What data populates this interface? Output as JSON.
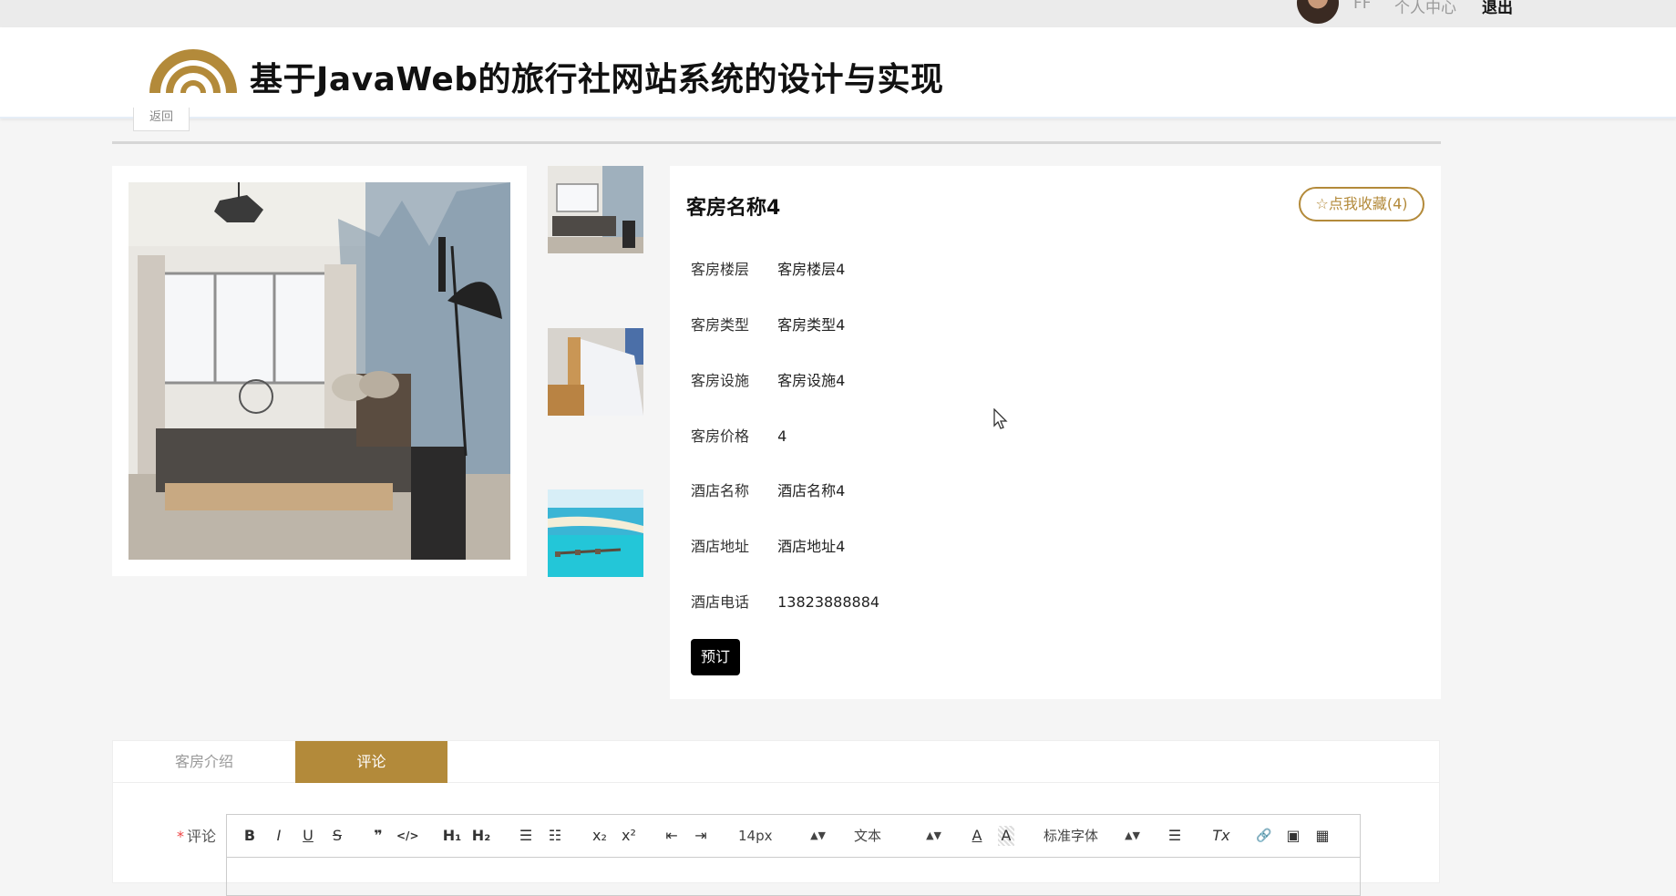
{
  "topbar": {
    "user_initial": "FF",
    "personal_center": "个人中心",
    "logout": "退出"
  },
  "header": {
    "site_title": "基于JavaWeb的旅行社网站系统的设计与实现",
    "accent_color": "#b38a3a"
  },
  "back_label": "返回",
  "room": {
    "title": "客房名称4",
    "favorite_label": "☆点我收藏(4)",
    "fields": [
      {
        "label": "客房楼层",
        "value": "客房楼层4"
      },
      {
        "label": "客房类型",
        "value": "客房类型4"
      },
      {
        "label": "客房设施",
        "value": "客房设施4"
      },
      {
        "label": "客房价格",
        "value": "4"
      },
      {
        "label": "酒店名称",
        "value": "酒店名称4"
      },
      {
        "label": "酒店地址",
        "value": "酒店地址4"
      },
      {
        "label": "酒店电话",
        "value": "13823888884"
      }
    ],
    "book_label": "预订"
  },
  "tabs": [
    {
      "label": "客房介绍",
      "active": false
    },
    {
      "label": "评论",
      "active": true
    }
  ],
  "comment": {
    "required_mark": "*",
    "label": "评论",
    "toolbar": {
      "bold": "B",
      "italic": "I",
      "underline": "U",
      "strike": "S",
      "quote": "❞",
      "code": "</>",
      "h1": "H₁",
      "h2": "H₂",
      "ordered_list": "☰",
      "bullet_list": "☷",
      "sub": "x₂",
      "sup": "x²",
      "outdent": "⇤",
      "indent": "⇥",
      "size_value": "14px",
      "format_value": "文本",
      "color": "A",
      "background": "A",
      "font_value": "标准字体",
      "align": "☰",
      "clean": "Tx",
      "link": "🔗",
      "image": "▣",
      "video": "▦"
    }
  }
}
